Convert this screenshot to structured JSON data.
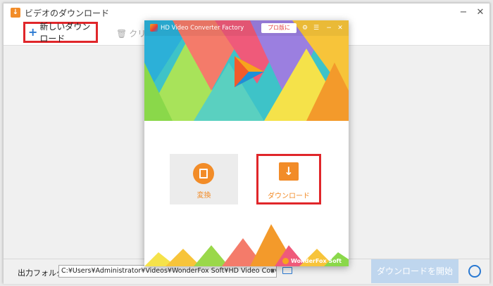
{
  "window": {
    "title": "ビデオのダウンロード",
    "app_icon": "download-app-icon",
    "controls": {
      "minimize": "−",
      "close": "✕"
    }
  },
  "toolbar": {
    "new_download_label": "新しいダウンロード",
    "clear_label": "クリア"
  },
  "bottom": {
    "output_folder_label": "出力フォルダ：",
    "output_path": "C:¥Users¥Administrator¥Videos¥WonderFox Soft¥HD Video Converter Factory¥Download_Video¥",
    "start_button_label": "ダウンロードを開始"
  },
  "popup": {
    "title": "HD Video Converter Factory",
    "pro_button_label": "プロ版に",
    "controls": {
      "settings": "⚙",
      "menu": "☰",
      "minimize": "−",
      "close": "✕"
    },
    "tiles": [
      {
        "label": "変換",
        "icon": "film-convert-icon"
      },
      {
        "label": "ダウンロード",
        "icon": "download-arrow-icon"
      }
    ],
    "brand": "WonderFox Soft"
  },
  "colors": {
    "accent_orange": "#f28c28",
    "highlight_red": "#e0262a",
    "link_blue": "#2a79d2",
    "start_button_disabled": "#bfd6ee"
  }
}
